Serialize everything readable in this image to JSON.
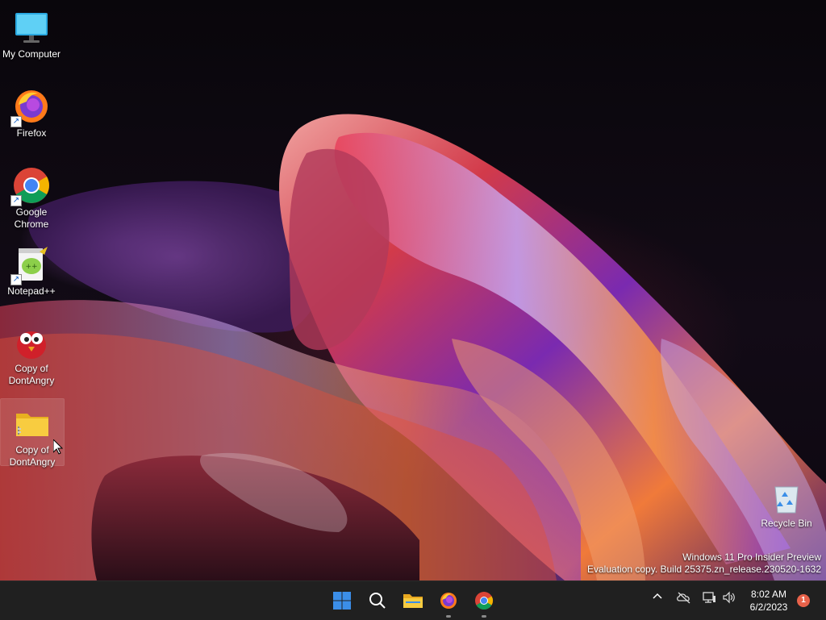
{
  "desktop": {
    "icons": [
      {
        "label": "My Computer",
        "icon": "monitor-icon"
      },
      {
        "label": "Firefox",
        "icon": "firefox-icon",
        "shortcut": true
      },
      {
        "label": "Google Chrome",
        "icon": "chrome-icon",
        "shortcut": true
      },
      {
        "label": "Notepad++",
        "icon": "notepadpp-icon",
        "shortcut": true
      },
      {
        "label": "Copy of DontAngry",
        "icon": "red-bird-icon"
      },
      {
        "label": "Copy of DontAngry",
        "icon": "zip-folder-icon",
        "selected": true
      }
    ],
    "recycle_bin": {
      "label": "Recycle Bin",
      "icon": "recycle-bin-icon"
    },
    "watermark": {
      "line1": "Windows 11 Pro Insider Preview",
      "line2": "Evaluation copy. Build 25375.zn_release.230520-1632"
    }
  },
  "taskbar": {
    "pinned": [
      {
        "name": "start",
        "icon": "windows-logo-icon"
      },
      {
        "name": "search",
        "icon": "search-icon"
      },
      {
        "name": "file-explorer",
        "icon": "folder-icon"
      },
      {
        "name": "firefox",
        "icon": "firefox-icon",
        "running": true
      },
      {
        "name": "chrome",
        "icon": "chrome-icon",
        "running": true
      }
    ],
    "tray": {
      "icons": [
        "chevron-up-icon",
        "onedrive-offline-icon",
        "network-icon",
        "volume-icon"
      ],
      "time": "8:02 AM",
      "date": "6/2/2023",
      "notification_count": "1"
    }
  },
  "colors": {
    "taskbar_bg": "#202020",
    "accent_blue": "#3b8ee8",
    "badge": "#e8624a"
  }
}
